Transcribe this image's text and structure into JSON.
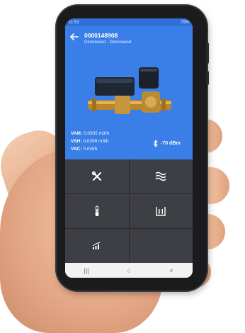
{
  "status_bar": {
    "time": "11:53",
    "battery": "79%"
  },
  "device": {
    "title": "0000148908",
    "subtitle": "Demowand  ·  Demowand"
  },
  "readings": [
    {
      "label": "VAM:",
      "value": "0,0302 m3/h"
    },
    {
      "label": "VSH:",
      "value": "0,0299 m3/h"
    },
    {
      "label": "VSC:",
      "value": "0 m3/h"
    }
  ],
  "signal": {
    "value": "-70 dBm",
    "icon": "bluetooth-icon"
  },
  "tiles": [
    {
      "icon": "tools-icon"
    },
    {
      "icon": "flow-waves-icon"
    },
    {
      "icon": "thermometer-icon"
    },
    {
      "icon": "level-container-icon"
    },
    {
      "icon": "signal-chart-icon"
    },
    {
      "icon": ""
    }
  ],
  "nav": {
    "recent": "|||",
    "home": "○",
    "back": "<"
  },
  "colors": {
    "header": "#3a7ee8",
    "status_bar": "#2f6fd6",
    "tile": "#3e3f44"
  }
}
